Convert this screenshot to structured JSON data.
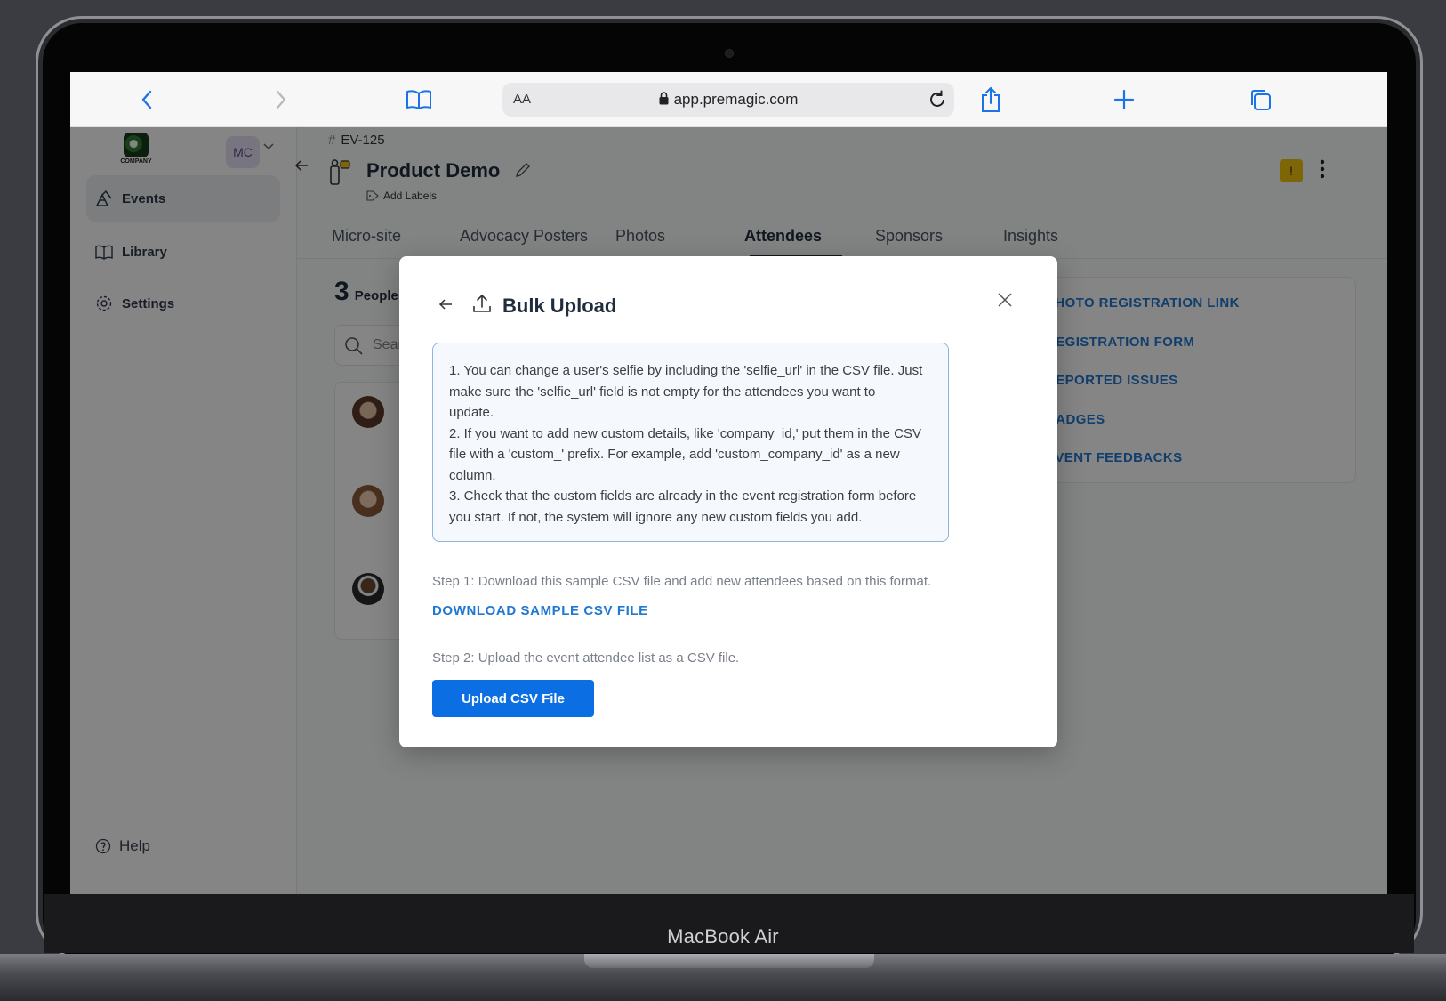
{
  "device": {
    "model_label": "MacBook Air"
  },
  "browser": {
    "aa_label": "AA",
    "url": "app.premagic.com"
  },
  "sidebar": {
    "logo_text": "COMPANY",
    "workspace_initials": "MC",
    "items": [
      {
        "label": "Events",
        "icon": "events-icon",
        "active": true
      },
      {
        "label": "Library",
        "icon": "book-icon",
        "active": false
      },
      {
        "label": "Settings",
        "icon": "gear-icon",
        "active": false
      }
    ],
    "help_label": "Help"
  },
  "event": {
    "id": "EV-125",
    "title": "Product Demo",
    "add_labels": "Add Labels",
    "warning_badge": "!"
  },
  "tabs": [
    {
      "label": "Micro-site"
    },
    {
      "label": "Advocacy Posters"
    },
    {
      "label": "Photos"
    },
    {
      "label": "Attendees",
      "active": true
    },
    {
      "label": "Sponsors"
    },
    {
      "label": "Insights"
    }
  ],
  "attendees": {
    "count": "3",
    "count_label": "People",
    "search_placeholder": "Sear"
  },
  "side_links": [
    "PHOTO REGISTRATION LINK",
    "REGISTRATION FORM",
    "REPORTED ISSUES",
    "BADGES",
    "EVENT FEEDBACKS"
  ],
  "modal": {
    "title": "Bulk Upload",
    "info_lines": [
      "1. You can change a user's selfie by including the 'selfie_url' in the CSV file. Just",
      "make sure the 'selfie_url' field is not empty for the attendees you want to",
      "update.",
      "2. If you want to add new custom details, like 'company_id,' put them in the CSV",
      "file with a 'custom_' prefix. For example, add 'custom_company_id' as a new",
      "column.",
      "3. Check that the custom fields are already in the event registration form before",
      "you start. If not, the system will ignore any new custom fields you add."
    ],
    "step1": "Step 1: Download this sample CSV file and add new attendees based on this format.",
    "download_link": "DOWNLOAD SAMPLE CSV FILE",
    "step2": "Step 2: Upload the event attendee list as a CSV file.",
    "upload_button": "Upload CSV File"
  },
  "colors": {
    "accent": "#0b6fe3",
    "link": "#1f78d1",
    "warning": "#f1c40f",
    "info_border": "#8fb4e3"
  }
}
